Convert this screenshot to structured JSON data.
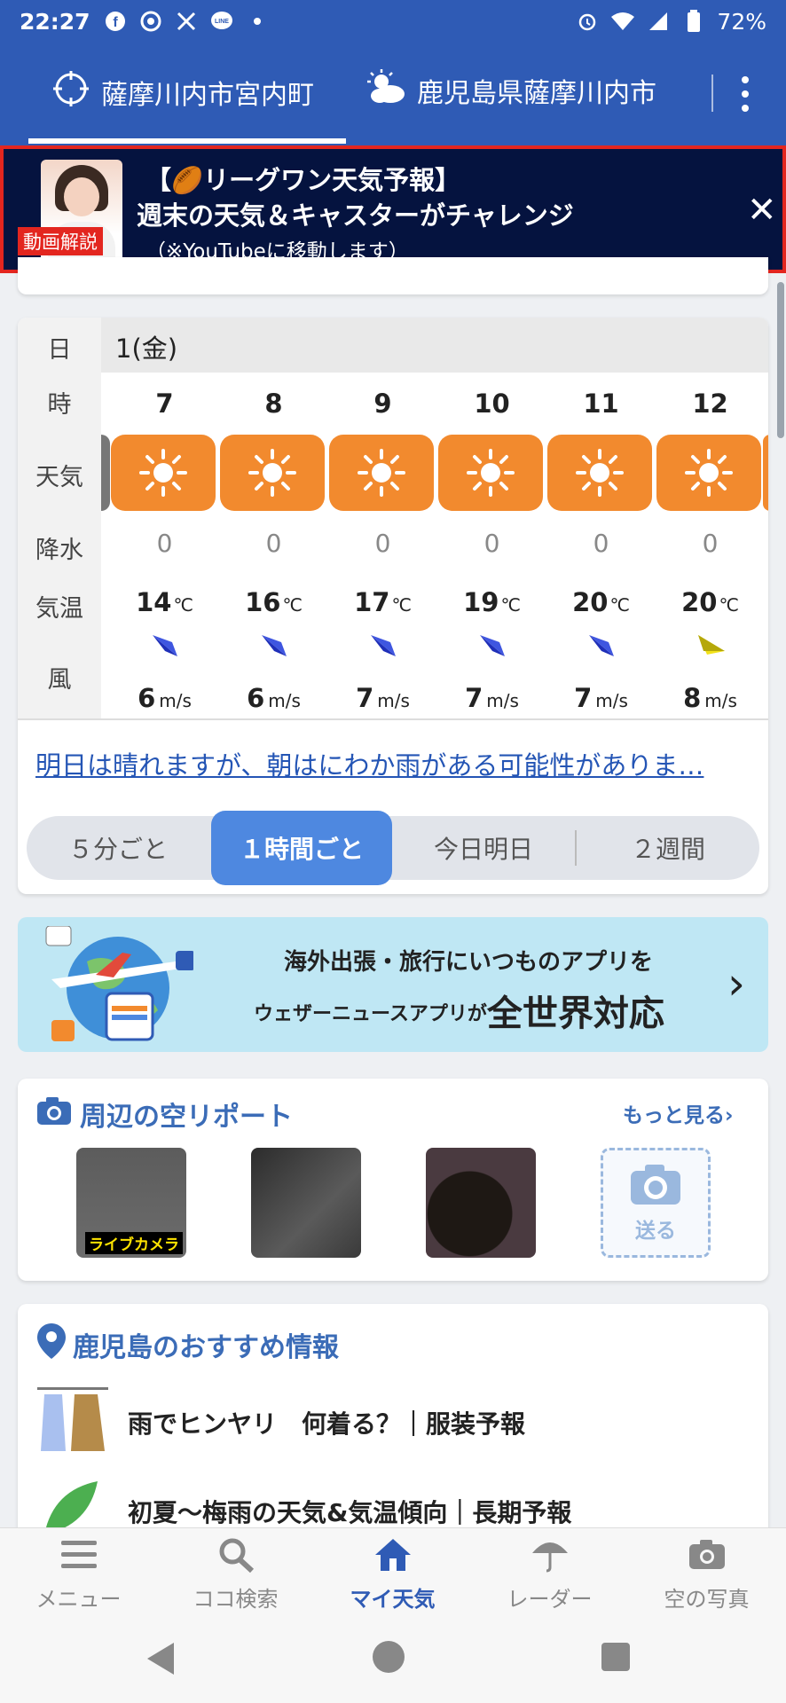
{
  "status_bar": {
    "time": "22:27",
    "battery": "72%",
    "colors": {
      "bg": "#2f5bb5"
    }
  },
  "header": {
    "tab1": "薩摩川内市宮内町",
    "tab2": "鹿児島県薩摩川内市"
  },
  "banner": {
    "badge": "動画解説",
    "line1": "【🏉リーグワン天気予報】",
    "line2": "週末の天気＆キャスターがチャレンジ",
    "line3": "（※YouTubeに移動します）",
    "close": "✕"
  },
  "forecast": {
    "labels": {
      "day": "日",
      "hour": "時",
      "weather": "天気",
      "precip": "降水",
      "temp": "気温",
      "wind": "風"
    },
    "date": "1(金)",
    "hours": [
      {
        "hour": "7",
        "weather_icon": "sun-icon",
        "precip": "0",
        "temp": "14",
        "temp_unit": "℃",
        "wind_dir": "navy",
        "wind_speed": "6",
        "wind_unit": "m/s"
      },
      {
        "hour": "8",
        "weather_icon": "sun-icon",
        "precip": "0",
        "temp": "16",
        "temp_unit": "℃",
        "wind_dir": "navy",
        "wind_speed": "6",
        "wind_unit": "m/s"
      },
      {
        "hour": "9",
        "weather_icon": "sun-icon",
        "precip": "0",
        "temp": "17",
        "temp_unit": "℃",
        "wind_dir": "navy",
        "wind_speed": "7",
        "wind_unit": "m/s"
      },
      {
        "hour": "10",
        "weather_icon": "sun-icon",
        "precip": "0",
        "temp": "19",
        "temp_unit": "℃",
        "wind_dir": "navy",
        "wind_speed": "7",
        "wind_unit": "m/s"
      },
      {
        "hour": "11",
        "weather_icon": "sun-icon",
        "precip": "0",
        "temp": "20",
        "temp_unit": "℃",
        "wind_dir": "navy",
        "wind_speed": "7",
        "wind_unit": "m/s"
      },
      {
        "hour": "12",
        "weather_icon": "sun-icon",
        "precip": "0",
        "temp": "20",
        "temp_unit": "℃",
        "wind_dir": "yellow",
        "wind_speed": "8",
        "wind_unit": "m/s"
      }
    ],
    "comment": "明日は晴れますが、朝はにわか雨がある可能性がありま…",
    "segments": [
      "５分ごと",
      "１時間ごと",
      "今日明日",
      "２週間"
    ],
    "active_segment": "１時間ごと",
    "colors": {
      "weather_bg": "#f28a2e",
      "active": "#4e88e0"
    }
  },
  "promo": {
    "line1": "海外出張・旅行にいつものアプリを",
    "line2_prefix": "ウェザーニュースアプリが",
    "line2_emphasis": "全世界対応"
  },
  "sky_report": {
    "title": "周辺の空リポート",
    "more": "もっと見る",
    "live_label": "ライブカメラ",
    "send_label": "送る"
  },
  "recommend": {
    "title": "鹿児島のおすすめ情報",
    "items": [
      "雨でヒンヤリ　何着る？｜服装予報",
      "初夏～梅雨の天気&気温傾向｜長期予報"
    ]
  },
  "bottom_nav": {
    "items": [
      "メニュー",
      "ココ検索",
      "マイ天気",
      "レーダー",
      "空の写真"
    ],
    "active": "マイ天気"
  }
}
